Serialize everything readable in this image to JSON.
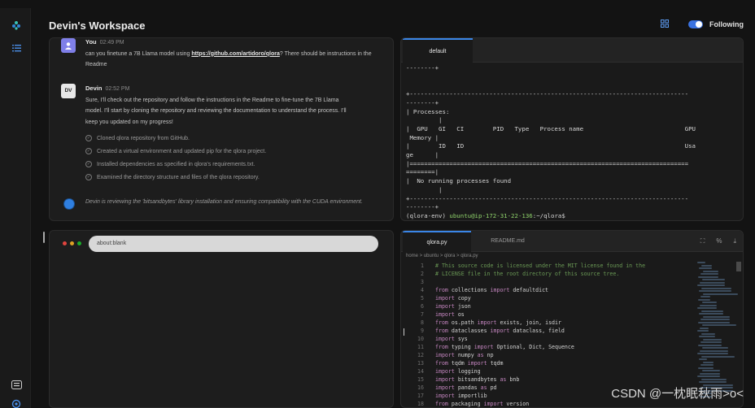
{
  "header": {
    "title": "Devin's Workspace",
    "following_label": "Following"
  },
  "chat": {
    "user_msg": {
      "author": "You",
      "time": "02:49 PM",
      "text_before": "can you finetune a 7B Llama model using ",
      "link": "https://github.com/artidoro/qlora",
      "text_after": "? There should be instructions in the Readme"
    },
    "devin_msg": {
      "avatar": "DV",
      "author": "Devin",
      "time": "02:52 PM",
      "text": "Sure, I'll check out the repository and follow the instructions in the Readme to fine-tune the 7B Llama model. I'll start by cloning the repository and reviewing the documentation to understand the process. I'll keep you updated on my progress!"
    },
    "steps": [
      "Cloned qlora repository from GitHub.",
      "Created a virtual environment and updated pip for the qlora project.",
      "Installed dependencies as specified in qlora's requirements.txt.",
      "Examined the directory structure and files of the qlora repository."
    ],
    "status": "Devin is reviewing the 'bitsandbytes' library installation and ensuring compatibility with the CUDA environment."
  },
  "browser": {
    "url": "about:blank"
  },
  "terminal": {
    "tab": "default",
    "lines": [
      "--------+",
      "",
      "",
      "+-----------------------------------------------------------------------------",
      "--------+",
      "| Processes:",
      "         |",
      "|  GPU   GI   CI        PID   Type   Process name                            GPU",
      " Memory |",
      "|        ID   ID                                                             Usa",
      "ge      |",
      "|=============================================================================",
      "========|",
      "|  No running processes found",
      "         |",
      "+-----------------------------------------------------------------------------",
      "--------+"
    ],
    "prompt_env": "(qlora-env) ",
    "prompt_user": "ubuntu@ip-172-31-22-136",
    "prompt_path": ":~/qlora$"
  },
  "editor": {
    "tabs": [
      "qlora.py",
      "README.md"
    ],
    "breadcrumb": "home > ubuntu > qlora > qlora.py",
    "code": [
      {
        "n": "1",
        "t": "# This source code is licensed under the MIT license found in the",
        "c": true
      },
      {
        "n": "2",
        "t": "# LICENSE file in the root directory of this source tree.",
        "c": true
      },
      {
        "n": "3",
        "t": ""
      },
      {
        "n": "4",
        "t": "from collections import defaultdict"
      },
      {
        "n": "5",
        "t": "import copy"
      },
      {
        "n": "6",
        "t": "import json"
      },
      {
        "n": "7",
        "t": "import os"
      },
      {
        "n": "8",
        "t": "from os.path import exists, join, isdir"
      },
      {
        "n": "9",
        "t": "from dataclasses import dataclass, field"
      },
      {
        "n": "10",
        "t": "import sys"
      },
      {
        "n": "11",
        "t": "from typing import Optional, Dict, Sequence"
      },
      {
        "n": "12",
        "t": "import numpy as np"
      },
      {
        "n": "13",
        "t": "from tqdm import tqdm"
      },
      {
        "n": "14",
        "t": "import logging"
      },
      {
        "n": "15",
        "t": "import bitsandbytes as bnb"
      },
      {
        "n": "16",
        "t": "import pandas as pd"
      },
      {
        "n": "17",
        "t": "import importlib"
      },
      {
        "n": "18",
        "t": "from packaging import version"
      }
    ]
  },
  "watermark": "CSDN @一枕眠秋雨>o<"
}
